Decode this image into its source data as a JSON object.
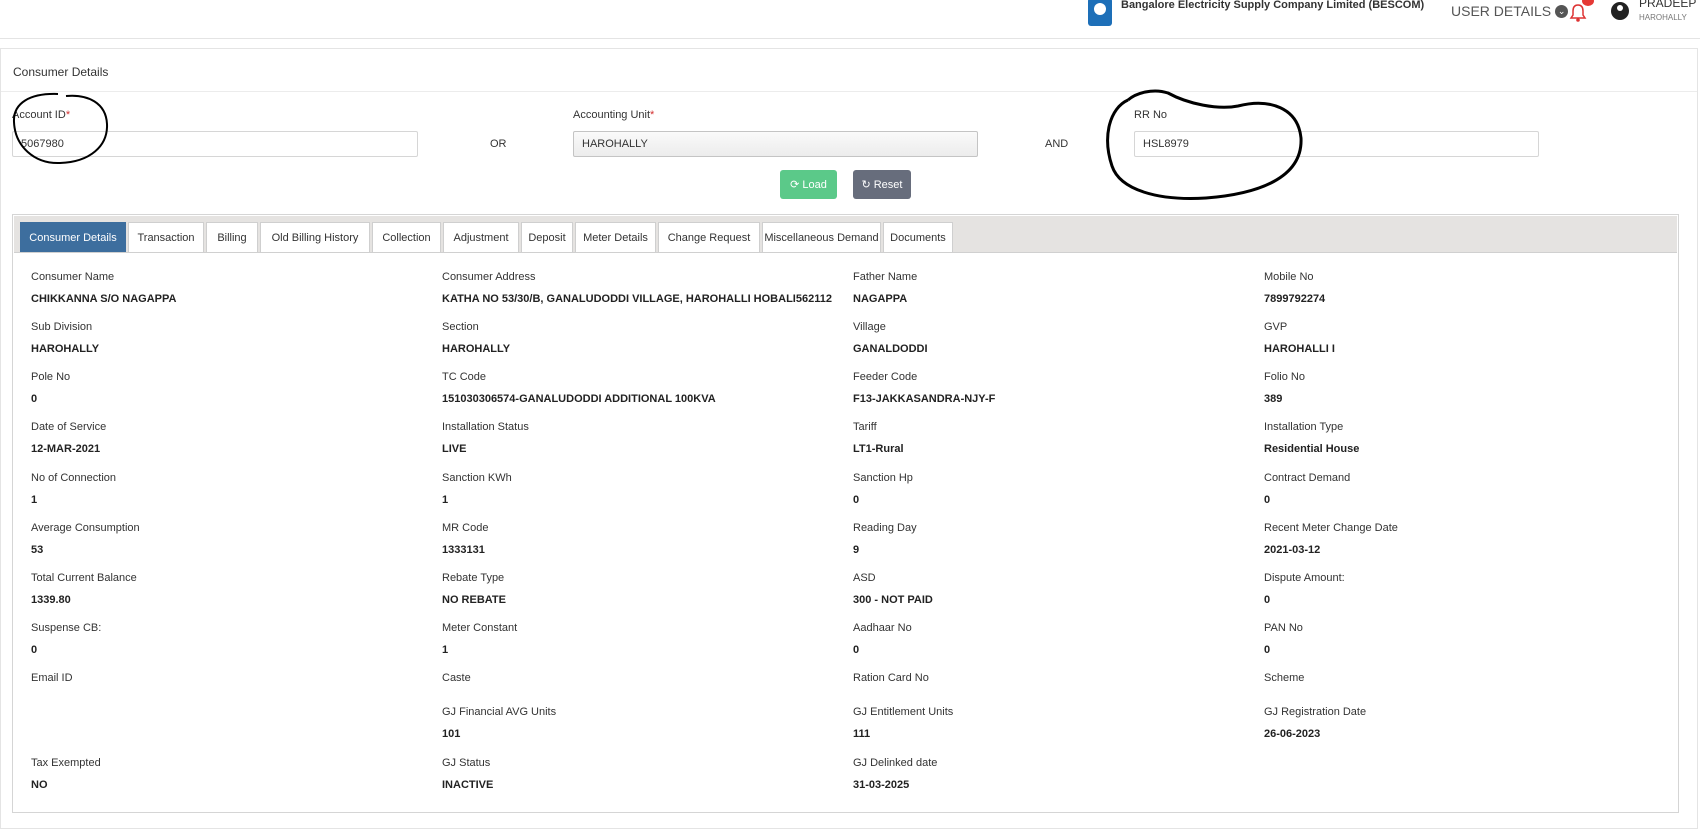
{
  "header": {
    "brand": "Bangalore Electricity Supply Company Limited (BESCOM)",
    "user_details_label": "USER DETAILS",
    "user_name": "PRADEEP C",
    "user_location": "HAROHALLY"
  },
  "panel": {
    "title": "Consumer Details"
  },
  "search": {
    "account_id_label": "Account ID",
    "account_id_value": "5067980",
    "or_label": "OR",
    "accounting_unit_label": "Accounting Unit",
    "accounting_unit_value": "HAROHALLY",
    "and_label": "AND",
    "rr_no_label": "RR No",
    "rr_no_value": "HSL8979",
    "required_mark": "*",
    "load_label": "Load",
    "reset_label": "Reset"
  },
  "tabs": [
    {
      "label": "Consumer Details",
      "active": true
    },
    {
      "label": "Transaction"
    },
    {
      "label": "Billing"
    },
    {
      "label": "Old Billing History"
    },
    {
      "label": "Collection"
    },
    {
      "label": "Adjustment"
    },
    {
      "label": "Deposit"
    },
    {
      "label": "Meter Details"
    },
    {
      "label": "Change Request"
    },
    {
      "label": "Miscellaneous Demand"
    },
    {
      "label": "Documents"
    }
  ],
  "details": [
    [
      {
        "label": "Consumer Name",
        "value": "CHIKKANNA S/O NAGAPPA"
      },
      {
        "label": "Consumer Address",
        "value": "KATHA NO 53/30/B, GANALUDODDI VILLAGE, HAROHALLI HOBALI562112"
      },
      {
        "label": "Father Name",
        "value": "NAGAPPA"
      },
      {
        "label": "Mobile No",
        "value": "7899792274"
      }
    ],
    [
      {
        "label": "Sub Division",
        "value": "HAROHALLY"
      },
      {
        "label": "Section",
        "value": "HAROHALLY"
      },
      {
        "label": "Village",
        "value": "GANALDODDI"
      },
      {
        "label": "GVP",
        "value": "HAROHALLI I"
      }
    ],
    [
      {
        "label": "Pole No",
        "value": "0"
      },
      {
        "label": "TC Code",
        "value": "151030306574-GANALUDODDI ADDITIONAL 100KVA"
      },
      {
        "label": "Feeder Code",
        "value": "F13-JAKKASANDRA-NJY-F"
      },
      {
        "label": "Folio No",
        "value": "389"
      }
    ],
    [
      {
        "label": "Date of Service",
        "value": "12-MAR-2021"
      },
      {
        "label": "Installation Status",
        "value": "LIVE"
      },
      {
        "label": "Tariff",
        "value": "LT1-Rural"
      },
      {
        "label": "Installation Type",
        "value": "Residential House"
      }
    ],
    [
      {
        "label": "No of Connection",
        "value": "1"
      },
      {
        "label": "Sanction KWh",
        "value": "1"
      },
      {
        "label": "Sanction Hp",
        "value": "0"
      },
      {
        "label": "Contract Demand",
        "value": "0"
      }
    ],
    [
      {
        "label": "Average Consumption",
        "value": "53"
      },
      {
        "label": "MR Code",
        "value": "1333131"
      },
      {
        "label": "Reading Day",
        "value": "9"
      },
      {
        "label": "Recent Meter Change Date",
        "value": "2021-03-12"
      }
    ],
    [
      {
        "label": "Total Current Balance",
        "value": "1339.80"
      },
      {
        "label": "Rebate Type",
        "value": "NO REBATE"
      },
      {
        "label": "ASD",
        "value": "300 - NOT PAID"
      },
      {
        "label": "Dispute Amount:",
        "value": "0"
      }
    ],
    [
      {
        "label": "Suspense CB:",
        "value": "0"
      },
      {
        "label": "Meter Constant",
        "value": "1"
      },
      {
        "label": "Aadhaar No",
        "value": "0"
      },
      {
        "label": "PAN No",
        "value": "0"
      }
    ],
    [
      {
        "label": "Email ID",
        "value": ""
      },
      {
        "label": "Caste",
        "value": ""
      },
      {
        "label": "Ration Card No",
        "value": ""
      },
      {
        "label": "Scheme",
        "value": ""
      }
    ],
    [
      {
        "label": "",
        "value": ""
      },
      {
        "label": "GJ Financial AVG Units",
        "value": "101"
      },
      {
        "label": "GJ Entitlement Units",
        "value": "111"
      },
      {
        "label": "GJ Registration Date",
        "value": "26-06-2023"
      }
    ],
    [
      {
        "label": "Tax Exempted",
        "value": "NO"
      },
      {
        "label": "GJ Status",
        "value": "INACTIVE"
      },
      {
        "label": "GJ Delinked date",
        "value": "31-03-2025"
      },
      {
        "label": "",
        "value": ""
      }
    ]
  ]
}
